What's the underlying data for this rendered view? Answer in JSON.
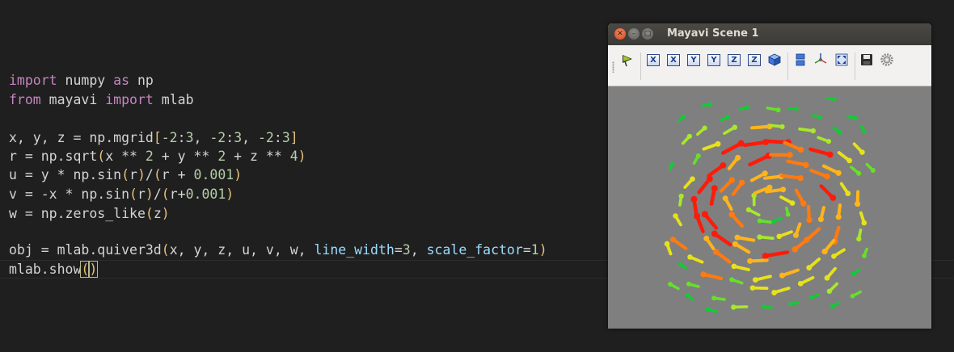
{
  "editor": {
    "lines": [
      {
        "text": "import numpy as np"
      },
      {
        "text": "from mayavi import mlab"
      },
      {
        "text": ""
      },
      {
        "text": "x, y, z = np.mgrid[-2:3, -2:3, -2:3]"
      },
      {
        "text": "r = np.sqrt(x ** 2 + y ** 2 + z ** 4)"
      },
      {
        "text": "u = y * np.sin(r)/(r + 0.001)"
      },
      {
        "text": "v = -x * np.sin(r)/(r+0.001)"
      },
      {
        "text": "w = np.zeros_like(z)"
      },
      {
        "text": ""
      },
      {
        "text": "obj = mlab.quiver3d(x, y, z, u, v, w, line_width=3, scale_factor=1)"
      },
      {
        "text": "mlab.show()"
      }
    ]
  },
  "window": {
    "title": "Mayavi Scene 1",
    "close_glyph": "✕",
    "minimize_glyph": "–",
    "maximize_glyph": "□",
    "toolbar": {
      "buttons": [
        {
          "name": "mayavi-engine-icon"
        },
        {
          "name": "view-x-plus",
          "label": "X"
        },
        {
          "name": "view-x-minus",
          "label": "X"
        },
        {
          "name": "view-y-plus",
          "label": "Y"
        },
        {
          "name": "view-y-minus",
          "label": "Y"
        },
        {
          "name": "view-z-plus",
          "label": "Z"
        },
        {
          "name": "view-z-minus",
          "label": "Z"
        },
        {
          "name": "isometric-view-icon"
        },
        {
          "name": "parallel-projection-icon"
        },
        {
          "name": "axes-indicator-icon"
        },
        {
          "name": "fullscreen-icon"
        },
        {
          "name": "save-icon"
        },
        {
          "name": "settings-icon"
        }
      ]
    }
  },
  "colors": {
    "scene_background": "#7f7f7f",
    "arrow_palette": [
      "#00e0ff",
      "#11cc33",
      "#66e02a",
      "#a8e82a",
      "#e6e21a",
      "#ffb41a",
      "#ff7a10",
      "#ff1a0a"
    ]
  }
}
